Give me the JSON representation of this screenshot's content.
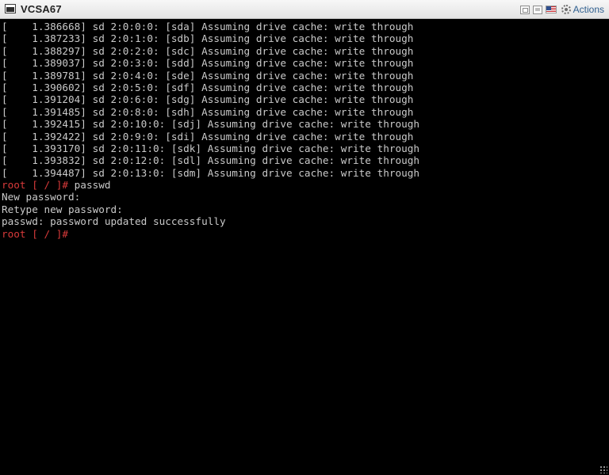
{
  "window": {
    "title": "VCSA67",
    "actions_label": "Actions",
    "icons": [
      "console-icon",
      "send-ctrl-alt-del-icon",
      "fullscreen-icon",
      "keyboard-layout-flag-icon",
      "gear-icon"
    ]
  },
  "console": {
    "boot_lines": [
      "[    1.386668] sd 2:0:0:0: [sda] Assuming drive cache: write through",
      "[    1.387233] sd 2:0:1:0: [sdb] Assuming drive cache: write through",
      "[    1.388297] sd 2:0:2:0: [sdc] Assuming drive cache: write through",
      "[    1.389037] sd 2:0:3:0: [sdd] Assuming drive cache: write through",
      "[    1.389781] sd 2:0:4:0: [sde] Assuming drive cache: write through",
      "[    1.390602] sd 2:0:5:0: [sdf] Assuming drive cache: write through",
      "[    1.391204] sd 2:0:6:0: [sdg] Assuming drive cache: write through",
      "[    1.391485] sd 2:0:8:0: [sdh] Assuming drive cache: write through",
      "[    1.392415] sd 2:0:10:0: [sdj] Assuming drive cache: write through",
      "[    1.392422] sd 2:0:9:0: [sdi] Assuming drive cache: write through",
      "[    1.393170] sd 2:0:11:0: [sdk] Assuming drive cache: write through",
      "[    1.393832] sd 2:0:12:0: [sdl] Assuming drive cache: write through",
      "[    1.394487] sd 2:0:13:0: [sdm] Assuming drive cache: write through"
    ],
    "prompt": "root [ / ]#",
    "command": " passwd",
    "output_lines": [
      "New password:",
      "Retype new password:",
      "passwd: password updated successfully"
    ],
    "final_prompt": "root [ / ]#"
  },
  "colors": {
    "background": "#000000",
    "text": "#c9c9c9",
    "prompt": "#d83a3a",
    "titlebar": "#ececec",
    "actions_link": "#2f5f8f"
  }
}
